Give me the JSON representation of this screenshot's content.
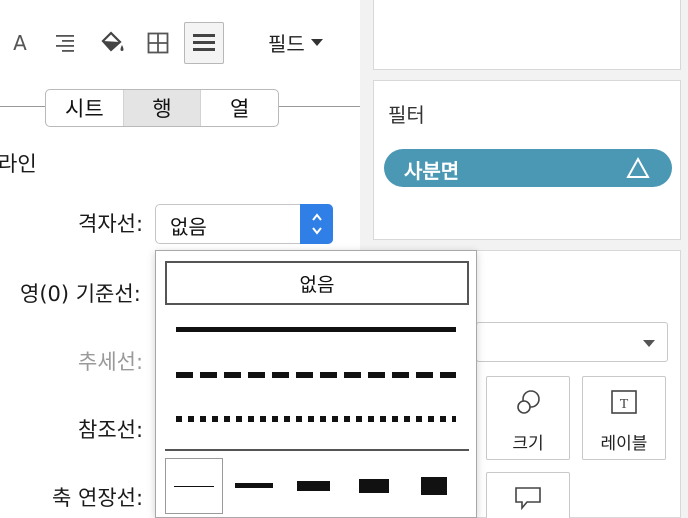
{
  "toolbar": {
    "icons": [
      "font-icon",
      "align-icon",
      "shading-icon",
      "borders-icon",
      "lines-icon"
    ],
    "font_icon_glyph": "A",
    "field_dropdown_label": "필드"
  },
  "tabs": [
    "시트",
    "행",
    "열"
  ],
  "active_tab": "행",
  "section_title": "라인",
  "rows": {
    "grid": "격자선:",
    "zero": "영(0) 기준선:",
    "trend": "추세선:",
    "ref": "참조선:",
    "axis": "축 연장선:"
  },
  "grid_select": {
    "value": "없음"
  },
  "line_popup": {
    "none_label": "없음",
    "patterns": [
      "solid",
      "dashed",
      "dotted"
    ],
    "weights": [
      1,
      2,
      3,
      4,
      5
    ]
  },
  "filters": {
    "title": "필터",
    "pill_label": "사분면",
    "pill_icon": "delta-icon"
  },
  "marks": {
    "buttons": [
      {
        "label": "크기",
        "icon": "size-icon"
      },
      {
        "label": "레이블",
        "icon": "label-icon"
      },
      {
        "label": "",
        "icon": "tooltip-icon"
      }
    ]
  },
  "colors": {
    "accent": "#2f7fe6",
    "filter_pill": "#4a98b4",
    "active_tab": "#e4e4e4"
  }
}
